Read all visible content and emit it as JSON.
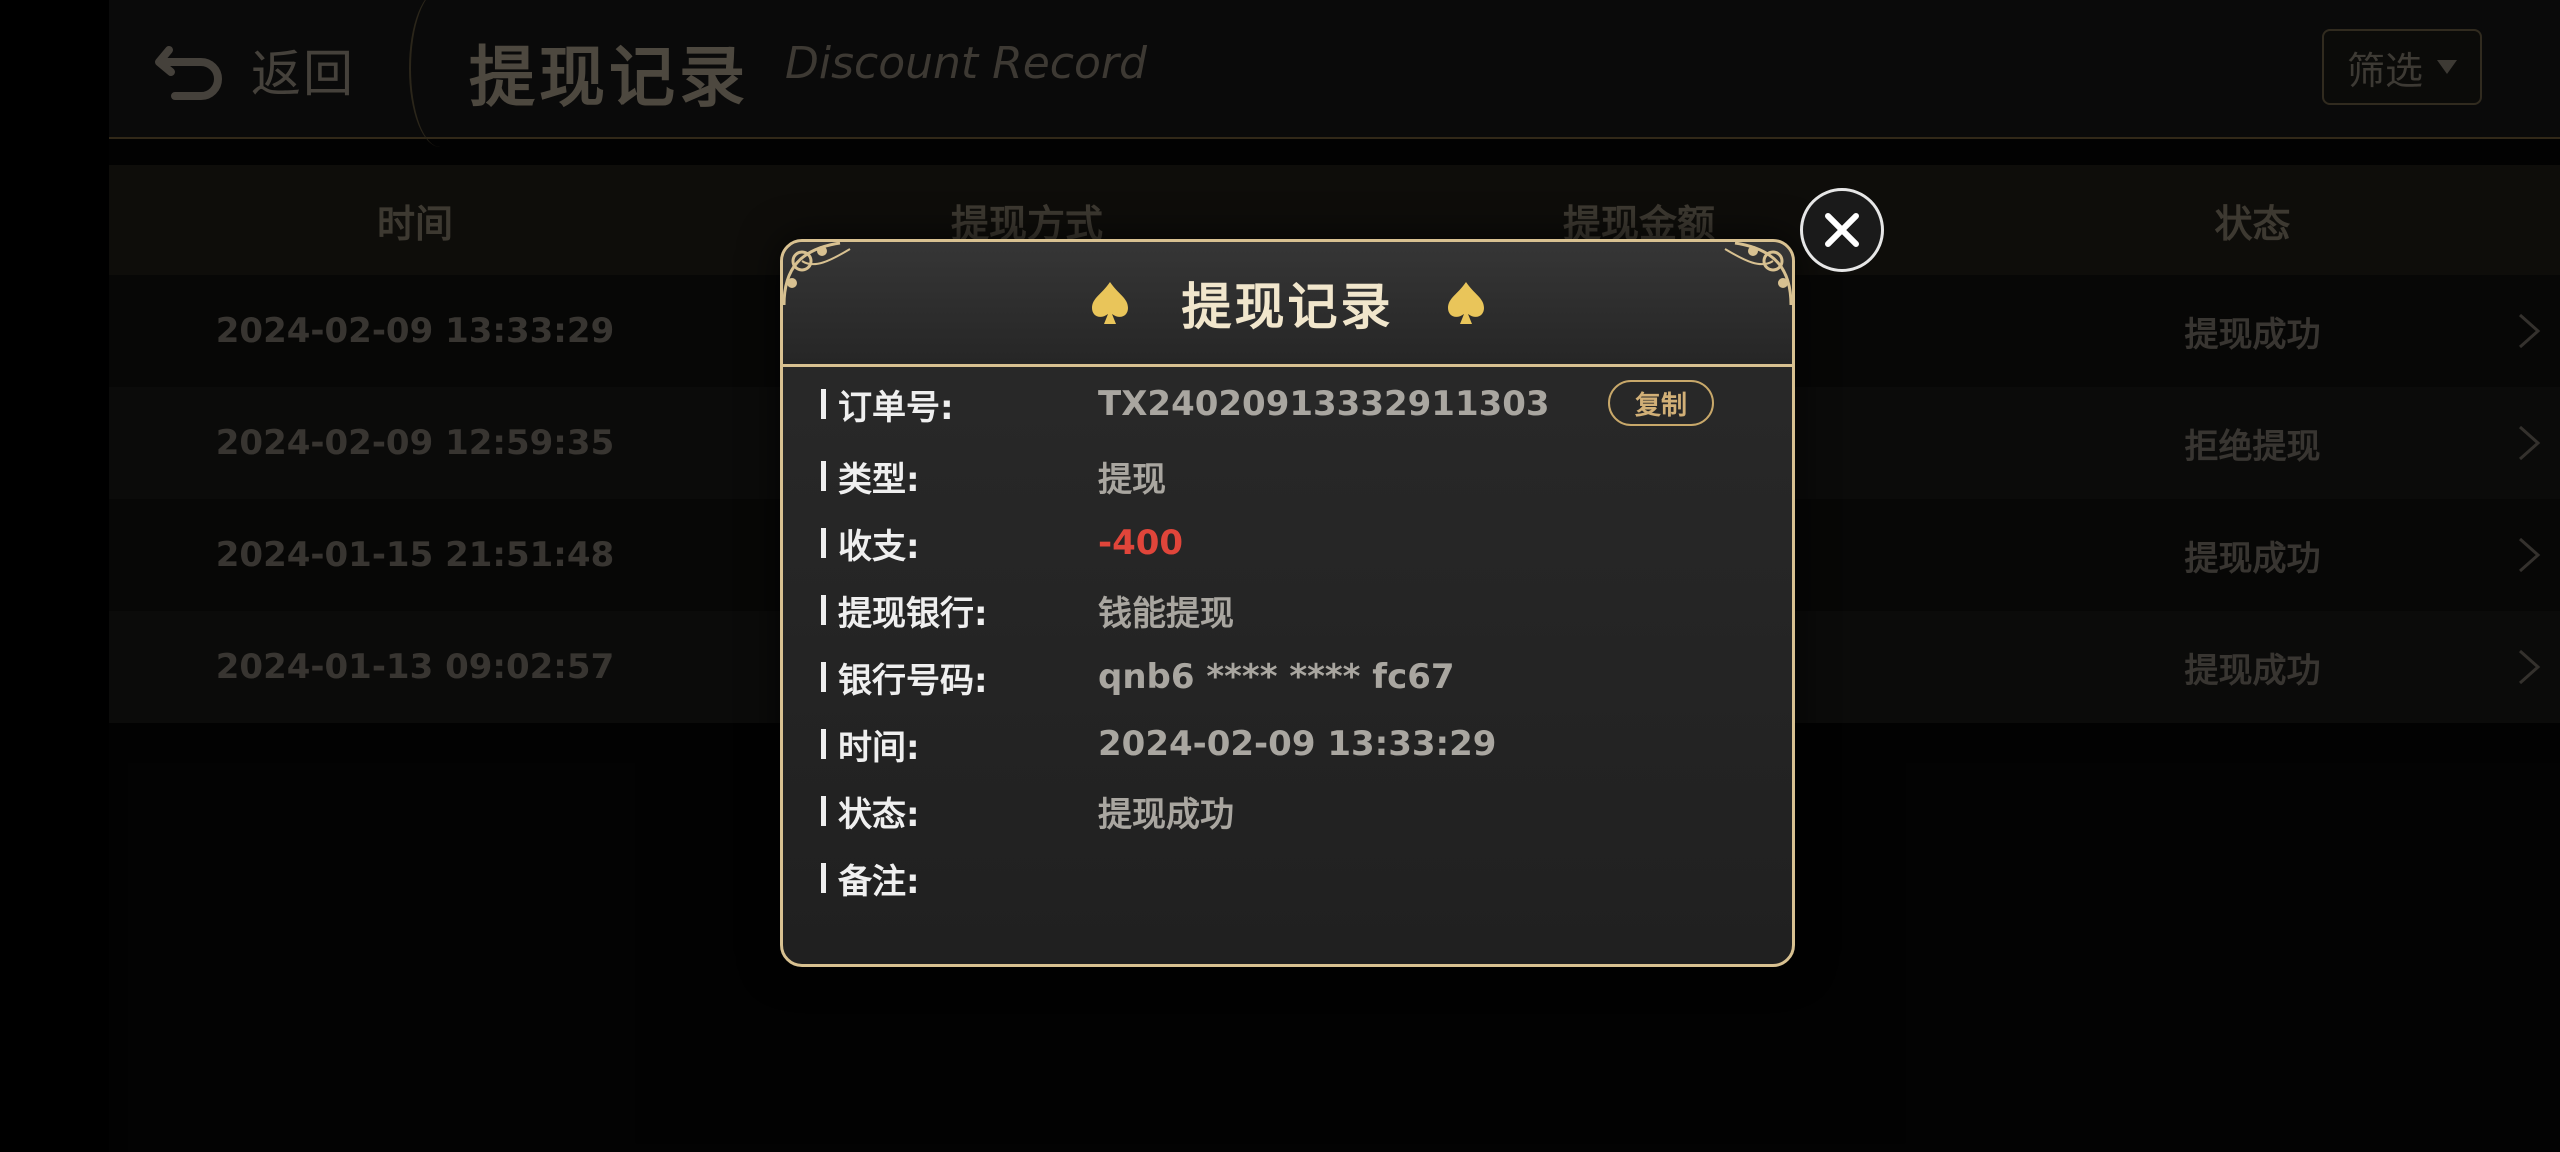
{
  "header": {
    "back_label": "返回",
    "title": "提现记录",
    "subtitle": "Discount Record",
    "filter_label": "筛选"
  },
  "table": {
    "columns": [
      "时间",
      "提现方式",
      "提现金额",
      "状态"
    ],
    "rows": [
      {
        "time": "2024-02-09 13:33:29",
        "status": "提现成功"
      },
      {
        "time": "2024-02-09 12:59:35",
        "status": "拒绝提现"
      },
      {
        "time": "2024-01-15 21:51:48",
        "status": "提现成功"
      },
      {
        "time": "2024-01-13 09:02:57",
        "status": "提现成功"
      }
    ]
  },
  "modal": {
    "title": "提现记录",
    "copy_label": "复制",
    "fields": {
      "order_no": {
        "label": "订单号:",
        "value": "TX24020913332911303"
      },
      "type": {
        "label": "类型:",
        "value": "提现"
      },
      "amount": {
        "label": "收支:",
        "value": "-400"
      },
      "bank": {
        "label": "提现银行:",
        "value": "钱能提现"
      },
      "account": {
        "label": "银行号码:",
        "value": "qnb6 **** **** fc67"
      },
      "time": {
        "label": "时间:",
        "value": "2024-02-09 13:33:29"
      },
      "status": {
        "label": "状态:",
        "value": "提现成功"
      },
      "remark": {
        "label": "备注:",
        "value": ""
      }
    }
  },
  "colors": {
    "accent_gold": "#d8c191",
    "negative_red": "#e0453a",
    "background": "#050505"
  },
  "icons": [
    "back-arrow-icon",
    "caret-down-icon",
    "chevron-right-icon",
    "spade-icon",
    "close-icon",
    "ornament-corner-icon"
  ]
}
